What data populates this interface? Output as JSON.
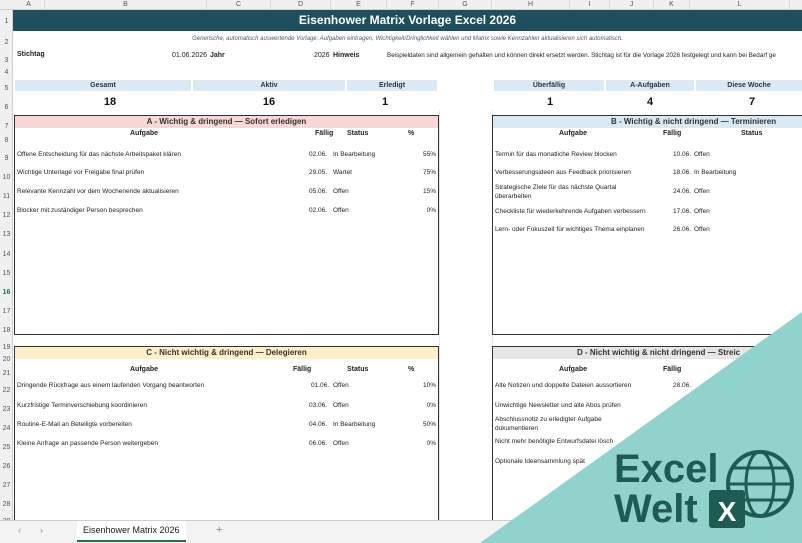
{
  "columns": [
    "A",
    "B",
    "C",
    "D",
    "E",
    "F",
    "G",
    "H",
    "I",
    "J",
    "K",
    "L"
  ],
  "rows": [
    "1",
    "2",
    "3",
    "4",
    "5",
    "6",
    "7",
    "8",
    "9",
    "10",
    "11",
    "12",
    "13",
    "14",
    "15",
    "16",
    "17",
    "18",
    "19",
    "20",
    "21",
    "22",
    "23",
    "24",
    "25",
    "26",
    "27",
    "28",
    "29"
  ],
  "title": "Eisenhower Matrix Vorlage Excel 2026",
  "subtitle": "Generische, automatisch auswertende Vorlage: Aufgaben eintragen, Wichtigkeit/Dringlichkeit wählen und Matrix sowie Kennzahlen aktualisieren sich automatisch.",
  "meta": {
    "stichtag_label": "Stichtag",
    "stichtag_value": "01.06.2026",
    "jahr_label": "Jahr",
    "jahr_value": "2026",
    "hinweis_label": "Hinweis",
    "hinweis_text": "Beispieldaten sind allgemein gehalten und können direkt ersetzt werden. Stichtag ist für die Vorlage 2026 festgelegt und kann bei Bedarf ge"
  },
  "kpis": [
    {
      "label": "Gesamt",
      "value": "18"
    },
    {
      "label": "Aktiv",
      "value": "16"
    },
    {
      "label": "Erledigt",
      "value": "1"
    },
    {
      "label": "Überfällig",
      "value": "1"
    },
    {
      "label": "A-Aufgaben",
      "value": "4"
    },
    {
      "label": "Diese Woche",
      "value": "7"
    }
  ],
  "quadrants": {
    "a": {
      "title": "A - Wichtig & dringend — Sofort erledigen",
      "head_color": "#f8d7d7",
      "cols": {
        "task": "Aufgabe",
        "due": "Fällig",
        "status": "Status",
        "pct": "%"
      },
      "rows": [
        {
          "task": "Offene Entscheidung für das nächste Arbeitspaket klären",
          "due": "02.06.",
          "status": "In Bearbeitung",
          "pct": "55%"
        },
        {
          "task": "Wichtige Unterlage vor Freigabe final prüfen",
          "due": "29.05.",
          "status": "Wartet",
          "pct": "75%"
        },
        {
          "task": "Relevante Kennzahl vor dem Wochenende aktualisieren",
          "due": "05.06.",
          "status": "Offen",
          "pct": "15%"
        },
        {
          "task": "Blocker mit zuständiger Person besprechen",
          "due": "02.06.",
          "status": "Offen",
          "pct": "0%"
        }
      ]
    },
    "b": {
      "title": "B - Wichtig & nicht dringend — Terminieren",
      "head_color": "#dbe9f5",
      "cols": {
        "task": "Aufgabe",
        "due": "Fällig",
        "status": "Status"
      },
      "rows": [
        {
          "task": "Termin für das monatliche Review blocken",
          "due": "10.06.",
          "status": "Offen"
        },
        {
          "task": "Verbesserungsideen aus Feedback priorisieren",
          "due": "18.06.",
          "status": "In Bearbeitung"
        },
        {
          "task": "Strategische Ziele für das nächste Quartal",
          "task2": "überarbeiten",
          "due": "24.06.",
          "status": "Offen"
        },
        {
          "task": "Checkliste für wiederkehrende Aufgaben verbessern",
          "due": "17.06.",
          "status": "Offen"
        },
        {
          "task": "Lern- oder Fokuszeit für wichtiges Thema einplanen",
          "due": "26.06.",
          "status": "Offen"
        }
      ]
    },
    "c": {
      "title": "C - Nicht wichtig & dringend — Delegieren",
      "head_color": "#fdf0c8",
      "cols": {
        "task": "Aufgabe",
        "due": "Fällig",
        "status": "Status",
        "pct": "%"
      },
      "rows": [
        {
          "task": "Dringende Rückfrage aus einem laufenden Vorgang beantworten",
          "due": "01.06.",
          "status": "Offen",
          "pct": "10%"
        },
        {
          "task": "Kurzfristige Terminverschiebung koordinieren",
          "due": "03.06.",
          "status": "Offen",
          "pct": "0%"
        },
        {
          "task": "Routine-E-Mail an Beteiligte vorbereiten",
          "due": "04.06.",
          "status": "In Bearbeitung",
          "pct": "50%"
        },
        {
          "task": "Kleine Anfrage an passende Person weitergeben",
          "due": "06.06.",
          "status": "Offen",
          "pct": "0%"
        }
      ]
    },
    "d": {
      "title": "D - Nicht wichtig & nicht dringend — Streic",
      "head_color": "#e6e6e6",
      "cols": {
        "task": "Aufgabe",
        "due": "Fällig"
      },
      "rows": [
        {
          "task": "Alte Notizen und doppelte Dateien aussortieren",
          "due": "28.06."
        },
        {
          "task": "Unwichtige Newsletter und alte Abos prüfen",
          "due": ""
        },
        {
          "task": "Abschlussnotiz zu erledigter Aufgabe",
          "task2": "dokumentieren",
          "due": ""
        },
        {
          "task": "Nicht mehr benötigte Entwurfsdatei lösch",
          "due": ""
        },
        {
          "task": "Optionale Ideensammlung spät",
          "due": ""
        }
      ]
    }
  },
  "sheet_tab": "Eisenhower Matrix 2026",
  "add_sheet": "+",
  "nav_prev": "‹",
  "nav_next": "›",
  "logo": {
    "line1": "Excel",
    "line2": "Welt",
    "badge": "X",
    "teal": "#8fd3cc",
    "dark": "#1d5b53"
  }
}
